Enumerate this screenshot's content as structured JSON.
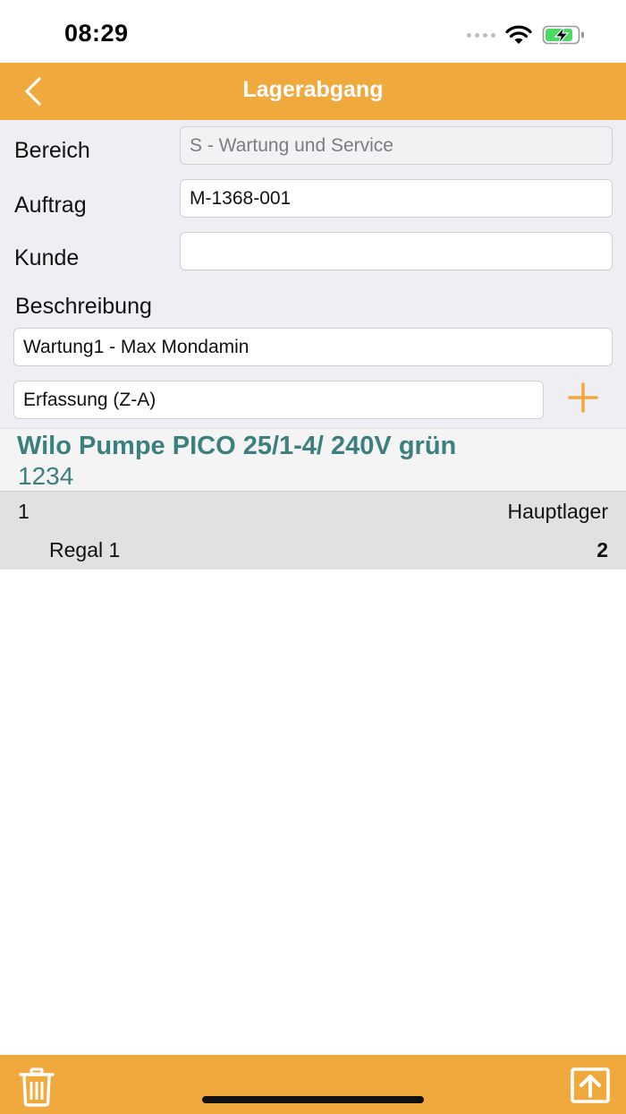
{
  "status_bar": {
    "time": "08:29",
    "icons": [
      "signal-dots-icon",
      "wifi-icon",
      "battery-charging-icon"
    ],
    "battery_color": "#4cd964"
  },
  "nav": {
    "title": "Lagerabgang",
    "back_icon": "chevron-left-icon"
  },
  "form": {
    "bereich_label": "Bereich",
    "bereich_value": "S - Wartung und Service",
    "auftrag_label": "Auftrag",
    "auftrag_value": "M-1368-001",
    "kunde_label": "Kunde",
    "kunde_value": "",
    "beschreibung_label": "Beschreibung",
    "beschreibung_value": "Wartung1 - Max Mondamin",
    "erfassung_value": "Erfassung (Z-A)",
    "add_icon": "plus-icon"
  },
  "article": {
    "name": "Wilo Pumpe PICO 25/1-4/ 240V grün",
    "number": "1234"
  },
  "stock": {
    "row1_left": "1",
    "row1_right": "Hauptlager",
    "row2_left": "Regal 1",
    "row2_right": "2"
  },
  "toolbar": {
    "left_icon": "trash-icon",
    "right_icon": "upload-icon"
  },
  "colors": {
    "accent": "#f0a93c",
    "article_text": "#3b807e",
    "form_background": "#efeff3"
  }
}
